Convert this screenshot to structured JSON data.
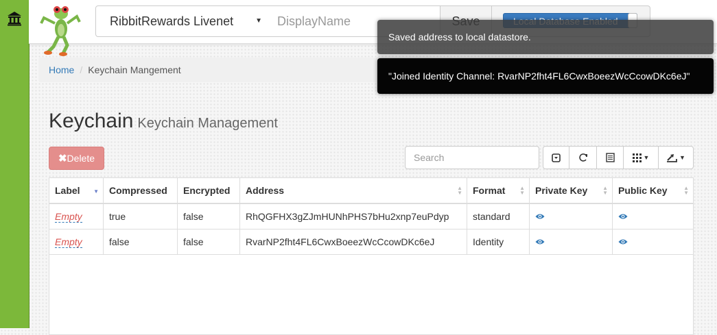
{
  "header": {
    "network": "RibbitRewards Livenet",
    "display_name_placeholder": "DisplayName",
    "save_label": "Save",
    "toggle_label": "Local Database Enabled"
  },
  "breadcrumb": {
    "home": "Home",
    "current": "Keychain Mangement"
  },
  "notifications": [
    "Saved address to local datastore.",
    "\"Joined Identity Channel: RvarNP2fht4FL6CwxBoeezWcCcowDKc6eJ\""
  ],
  "page": {
    "title": "Keychain",
    "subtitle": "Keychain Management"
  },
  "toolbar": {
    "delete_label": "Delete",
    "search_placeholder": "Search",
    "icons": [
      "toggle-icon",
      "refresh-icon",
      "list-icon",
      "columns-icon",
      "export-icon"
    ]
  },
  "table": {
    "columns": [
      "Label",
      "Compressed",
      "Encrypted",
      "Address",
      "Format",
      "Private Key",
      "Public Key"
    ],
    "rows": [
      {
        "label": "Empty",
        "compressed": "true",
        "encrypted": "false",
        "address": "RhQGFHX3gZJmHUNhPHS7bHu2xnp7euPdyp",
        "format": "standard"
      },
      {
        "label": "Empty",
        "compressed": "false",
        "encrypted": "false",
        "address": "RvarNP2fht4FL6CwxBoeezWcCcowDKc6eJ",
        "format": "Identity"
      }
    ]
  },
  "colors": {
    "sidebar": "#7cb83a",
    "toggle": "#3a7bbf",
    "delete": "#e48e8c",
    "link": "#337ab7",
    "empty_label": "#d9534f"
  }
}
